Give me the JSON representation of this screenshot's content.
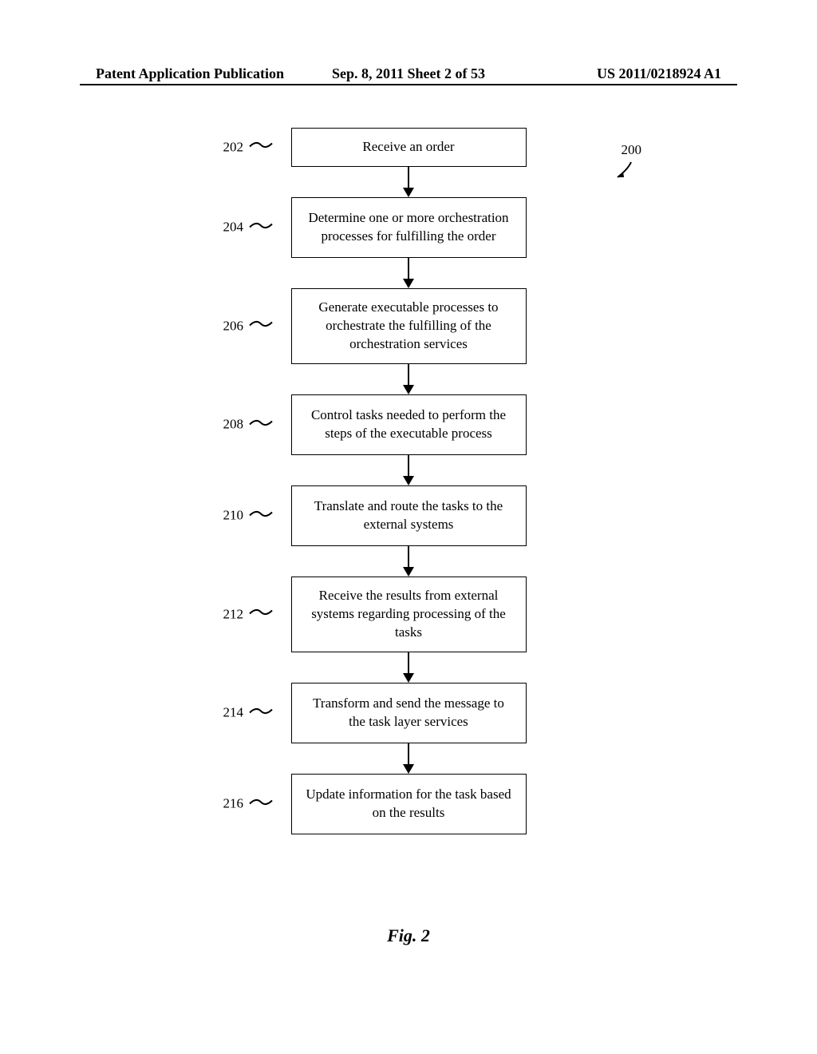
{
  "header": {
    "left": "Patent Application Publication",
    "center": "Sep. 8, 2011   Sheet 2 of 53",
    "right": "US 2011/0218924 A1"
  },
  "figure_ref": "200",
  "caption": "Fig. 2",
  "steps": [
    {
      "ref": "202",
      "text": "Receive an order",
      "short": true
    },
    {
      "ref": "204",
      "text": "Determine one or more orchestration processes for fulfilling the order"
    },
    {
      "ref": "206",
      "text": "Generate executable processes to orchestrate the fulfilling of the orchestration services"
    },
    {
      "ref": "208",
      "text": "Control tasks needed to perform the steps of the executable process"
    },
    {
      "ref": "210",
      "text": "Translate and route the tasks to the external systems"
    },
    {
      "ref": "212",
      "text": "Receive the results from external systems regarding processing of the tasks"
    },
    {
      "ref": "214",
      "text": "Transform and send the message to the task layer services"
    },
    {
      "ref": "216",
      "text": "Update information for the task based on the results"
    }
  ],
  "chart_data": {
    "type": "flowchart",
    "title": "Fig. 2",
    "reference_number": "200",
    "nodes": [
      {
        "id": "202",
        "label": "Receive an order"
      },
      {
        "id": "204",
        "label": "Determine one or more orchestration processes for fulfilling the order"
      },
      {
        "id": "206",
        "label": "Generate executable processes to orchestrate the fulfilling of the orchestration services"
      },
      {
        "id": "208",
        "label": "Control tasks needed to perform the steps of the executable process"
      },
      {
        "id": "210",
        "label": "Translate and route the tasks to the external systems"
      },
      {
        "id": "212",
        "label": "Receive the results from external systems regarding processing of the tasks"
      },
      {
        "id": "214",
        "label": "Transform and send the message to the task layer services"
      },
      {
        "id": "216",
        "label": "Update information for the task based on the results"
      }
    ],
    "edges": [
      {
        "from": "202",
        "to": "204"
      },
      {
        "from": "204",
        "to": "206"
      },
      {
        "from": "206",
        "to": "208"
      },
      {
        "from": "208",
        "to": "210"
      },
      {
        "from": "210",
        "to": "212"
      },
      {
        "from": "212",
        "to": "214"
      },
      {
        "from": "214",
        "to": "216"
      }
    ]
  }
}
